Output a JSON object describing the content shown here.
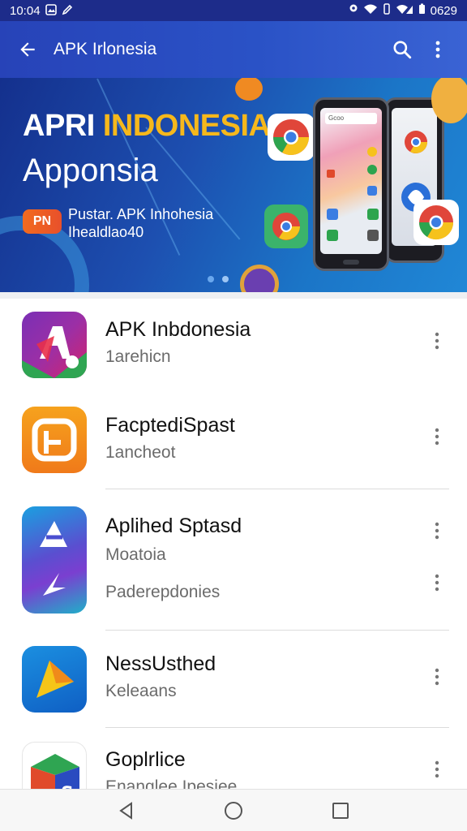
{
  "status_bar": {
    "time": "10:04",
    "battery": "0629"
  },
  "app_bar": {
    "title": "APK Irlonesia"
  },
  "banner": {
    "title_white": "APRI",
    "title_yellow": "INDONESIA",
    "subtitle": "Apponsia",
    "badge": "PN",
    "tagline_1": "Pustar. APK Inhohesia",
    "tagline_2": "Ihealdlao40",
    "phone_search_text": "Gcoo",
    "page_count": 2,
    "active_page": 1
  },
  "apps": [
    {
      "name": "APK Inbdonesia",
      "subtitle": "1arehicn",
      "icon_colors": [
        "#7a2fb5",
        "#d4236b",
        "#2fa552"
      ]
    },
    {
      "name": "FacptediSpast",
      "subtitle": "1ancheot",
      "icon_colors": [
        "#f6a21d",
        "#f07a1a"
      ]
    },
    {
      "name": "Aplihed Sptasd",
      "subtitle": "Moatoia",
      "subtitle_2": "Paderepdonies",
      "icon_colors": [
        "#1aa0e0",
        "#7a3fd0",
        "#1fb0c8"
      ]
    },
    {
      "name": "NessUsthed",
      "subtitle": "Keleaans",
      "icon_colors": [
        "#1b8fe0",
        "#0f5fc4",
        "#f5c518"
      ]
    },
    {
      "name": "Goplrlice",
      "subtitle": "Enanqlee Ipesiee",
      "icon_colors": [
        "#2fa552",
        "#e04a2b",
        "#2a4bc0"
      ]
    }
  ],
  "colors": {
    "status_bar": "#1d2c8a",
    "app_bar": "#2a4bc0",
    "accent_yellow": "#f6b81c"
  },
  "icons": {
    "back": "arrow-left-icon",
    "search": "search-icon",
    "overflow": "more-vert-icon",
    "nav_back": "triangle-back-icon",
    "nav_home": "circle-home-icon",
    "nav_recents": "square-recents-icon"
  }
}
